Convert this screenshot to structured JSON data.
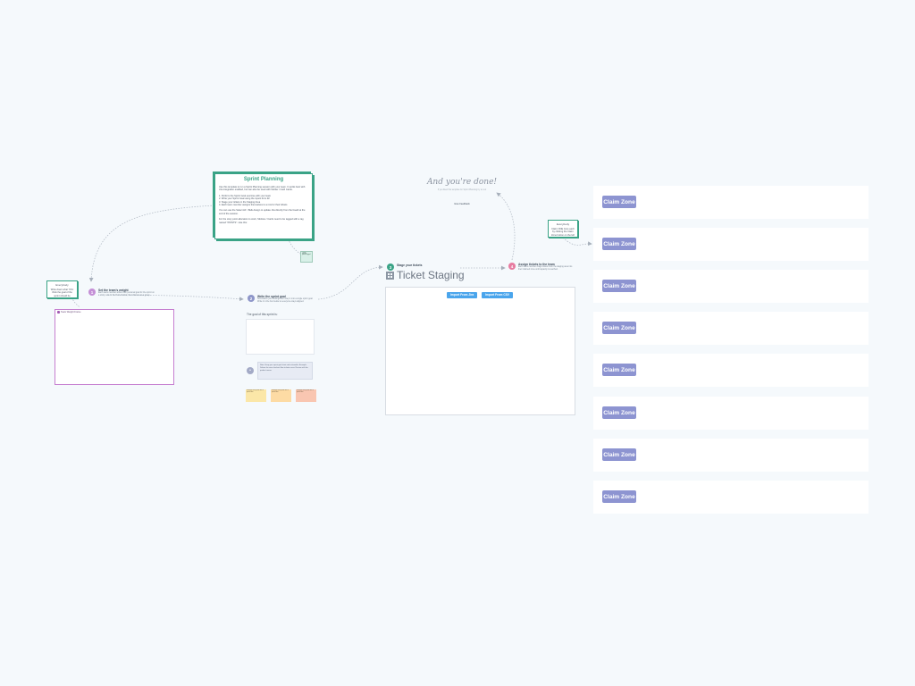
{
  "intro": {
    "title": "Sprint Planning",
    "p1": "Use this template to run a Sprint Planning session with your team. It works best with Jira integration enabled, but can also be used with Sticker / Card Cards.",
    "p2": "1. Perform the Sprint Goal exercise with your team\n2. Write your Sprint Goal using the inputs from #2\n3. Stage your tickets in the Staging Area\n4. Each team member assigns themselves to a row for their tickets",
    "p3": "You can use the Select All > Bulk Assign to update Jira directly from the board at the end of the session.",
    "p4": "For the story point allocation to work, Stickies / Cards need to be tagged with a tag named \"POINTS\". Like this:",
    "tiny_note": "Ticket sample: points tagged"
  },
  "callout_left": {
    "header": "Everybody",
    "body": "Write down what YOU think the goal of the sprint should be"
  },
  "callout_right": {
    "header": "Everybody",
    "body": "Claim ONE zone each by clicking the Claim Zone button on the left"
  },
  "steps": [
    {
      "num": "1",
      "title": "Set the team's weight",
      "desc": "Each team member writes their personal goal for the sprint on a sticky note in the frame below, then discuss as a group."
    },
    {
      "num": "2",
      "title": "Write the sprint goal",
      "desc": "Summarize your findings from step 1 into a single sprint goal. Write it in the box below so everyone stays aligned."
    },
    {
      "num": "3",
      "title": "Stage your tickets",
      "desc": ""
    },
    {
      "num": "4",
      "title": "Assign tickets to the team",
      "desc": "Each team member drags tickets from the staging area into their claimed zone until capacity is reached."
    }
  ],
  "frame": {
    "label": "Team Weight Frame"
  },
  "goal": {
    "label": "The goal of this sprint is:"
  },
  "grey_note": "Note: Keep your sprint goal short and actionable. Example: Deliver the new checkout flow to beta users. Review with the product owner.",
  "stickies": [
    {
      "text": "Example sticky note with a sprint idea",
      "color": "#fbe7a8"
    },
    {
      "text": "Example sticky note with a sprint idea",
      "color": "#fddba4"
    },
    {
      "text": "Example sticky note with a sprint idea",
      "color": "#f9c6b1"
    }
  ],
  "staging": {
    "title": "Ticket Staging",
    "import_jira": "Import From Jira",
    "import_csv": "Import From CSV"
  },
  "done": {
    "title": "And you're done!",
    "subtitle": "If you liked this template for Sprint Planning try us out",
    "link": "Give Feedback"
  },
  "zones": [
    {
      "label": "Claim Zone"
    },
    {
      "label": "Claim Zone"
    },
    {
      "label": "Claim Zone"
    },
    {
      "label": "Claim Zone"
    },
    {
      "label": "Claim Zone"
    },
    {
      "label": "Claim Zone"
    },
    {
      "label": "Claim Zone"
    },
    {
      "label": "Claim Zone"
    }
  ],
  "colors": {
    "teal": "#3aa386",
    "purple": "#c67fd0",
    "step_purple": "#c48fd6",
    "step_teal": "#3aa386",
    "step_pink": "#e77ba0",
    "step_slate": "#8e96c9",
    "claim": "#8d94d1",
    "import": "#4aa5ec"
  }
}
